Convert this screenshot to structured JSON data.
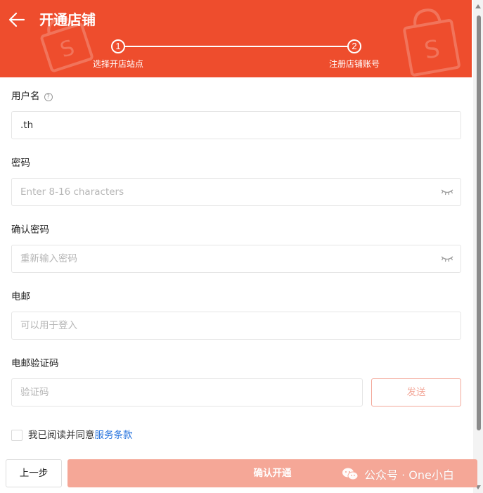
{
  "header": {
    "title": "开通店铺",
    "steps": [
      {
        "number": "1",
        "label": "选择开店站点"
      },
      {
        "number": "2",
        "label": "注册店铺账号"
      }
    ],
    "accent_color": "#ee4d2d"
  },
  "form": {
    "username": {
      "label": "用户名",
      "value": ".th",
      "placeholder": ""
    },
    "password": {
      "label": "密码",
      "placeholder": "Enter 8-16 characters"
    },
    "confirm_password": {
      "label": "确认密码",
      "placeholder": "重新输入密码"
    },
    "email": {
      "label": "电邮",
      "placeholder": "可以用于登入"
    },
    "email_code": {
      "label": "电邮验证码",
      "placeholder": "验证码",
      "send_label": "发送"
    }
  },
  "agreement": {
    "text": "我已阅读并同意",
    "link": "服务条款"
  },
  "footer": {
    "back_label": "上一步",
    "confirm_label": "确认开通",
    "watermark": "公众号 · One小白"
  }
}
